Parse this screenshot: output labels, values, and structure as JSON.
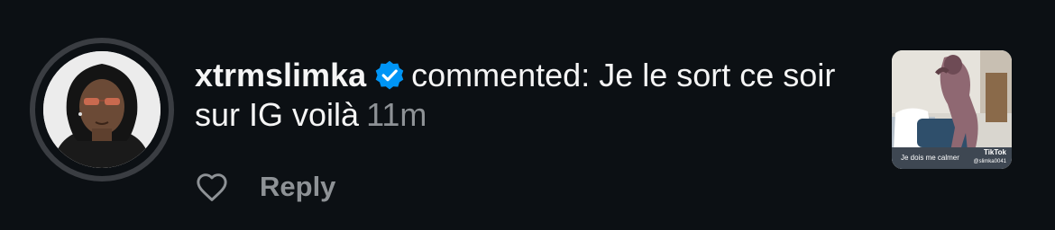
{
  "comment": {
    "username": "xtrmslimka",
    "action": "commented:",
    "text": "Je le sort ce soir sur IG voilà",
    "time": "11m"
  },
  "actions": {
    "reply_label": "Reply",
    "like_icon": "heart-outline-icon"
  },
  "thumbnail": {
    "caption": "Je dois me calmer",
    "logo": "TikTok",
    "handle": "@slimka0041"
  },
  "colors": {
    "background": "#0c1014",
    "text": "#f5f5f5",
    "muted": "#8e9296",
    "verified": "#0095f6"
  }
}
